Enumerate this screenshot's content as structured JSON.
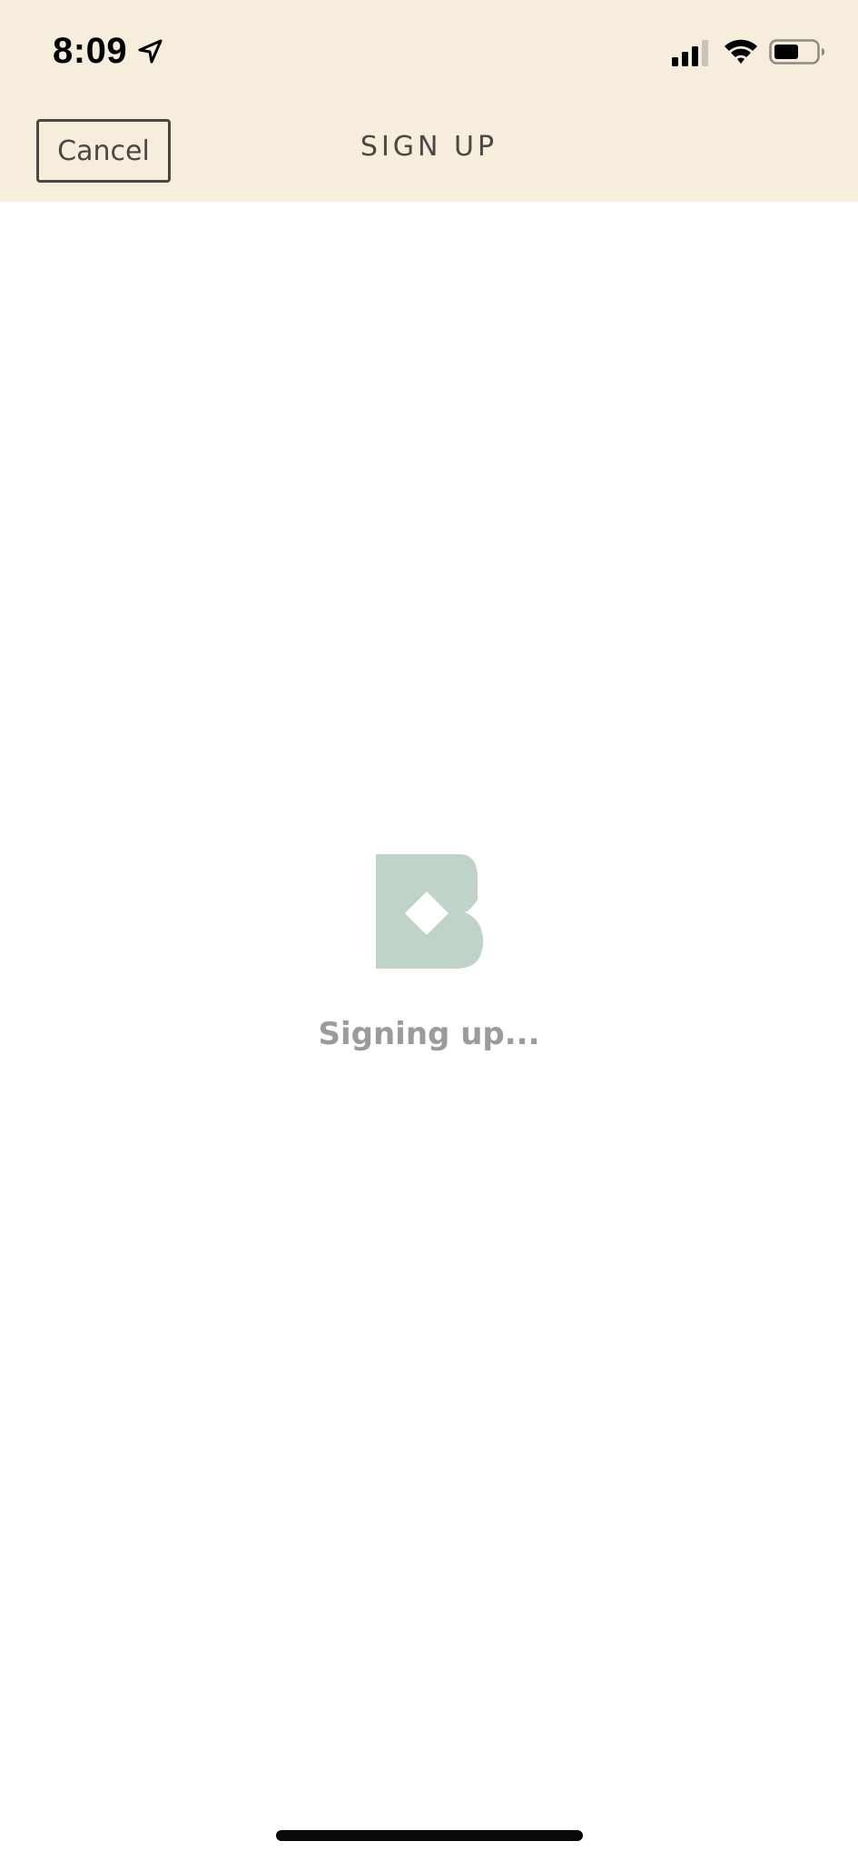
{
  "status_bar": {
    "time": "8:09",
    "location_icon": "location-arrow-icon",
    "signal_icon": "cellular-signal-icon",
    "wifi_icon": "wifi-icon",
    "battery_icon": "battery-icon"
  },
  "nav": {
    "cancel_label": "Cancel",
    "title": "SIGN UP"
  },
  "loading": {
    "logo_icon": "brand-logo-icon",
    "text": "Signing up..."
  },
  "colors": {
    "header_background": "#f6eddc",
    "logo": "#c0d3c8",
    "text_dark": "#4a4744",
    "text_muted": "#9d9b99"
  }
}
